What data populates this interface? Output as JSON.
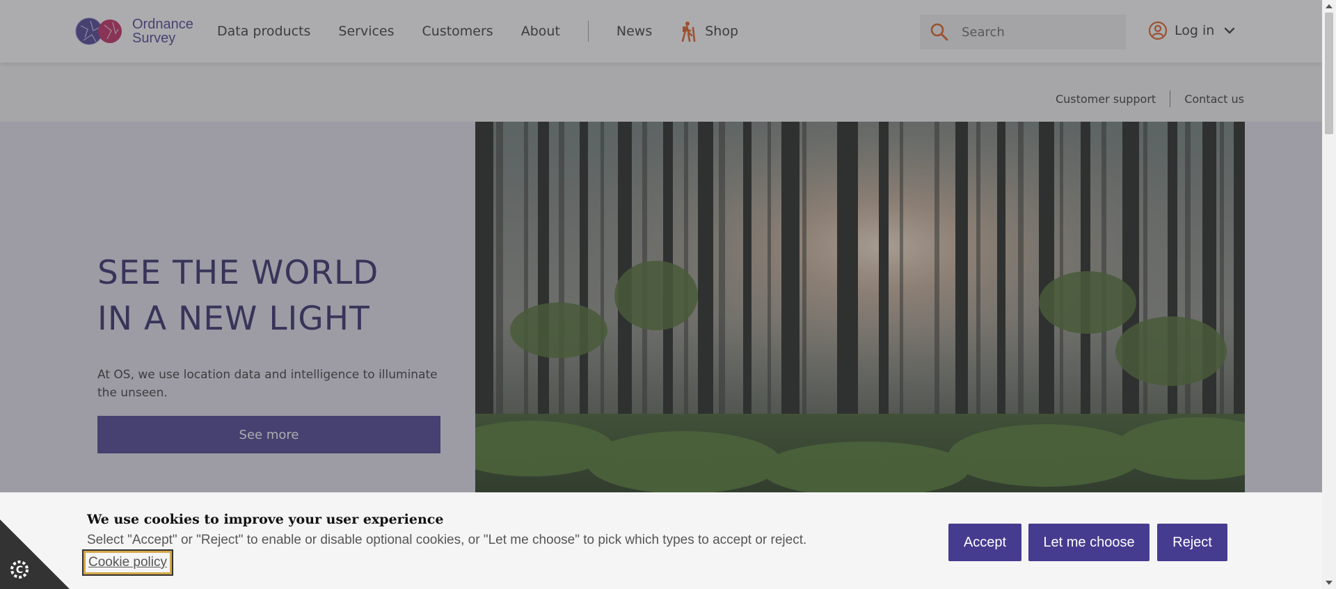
{
  "header": {
    "logo_text_line1": "Ordnance",
    "logo_text_line2": "Survey",
    "nav": [
      "Data products",
      "Services",
      "Customers",
      "About"
    ],
    "news": "News",
    "shop": "Shop",
    "search_placeholder": "Search",
    "login": "Log in"
  },
  "sublinks": {
    "support": "Customer support",
    "contact": "Contact us"
  },
  "hero": {
    "title_line1": "SEE THE WORLD",
    "title_line2": "IN A NEW LIGHT",
    "description": "At OS, we use location data and intelligence to illuminate the unseen.",
    "button": "See more"
  },
  "cookie": {
    "title": "We use cookies to improve your user experience",
    "text": "Select \"Accept\" or \"Reject\" to enable or disable optional cookies, or \"Let me choose\" to pick which types to accept or reject.",
    "policy_link": "Cookie policy",
    "accept": "Accept",
    "choose": "Let me choose",
    "reject": "Reject"
  },
  "colors": {
    "brand_purple": "#453c90",
    "accent_orange": "#e05a1c",
    "logo_magenta": "#c0255f"
  },
  "icons": [
    "os-logo",
    "hiker-icon",
    "search-icon",
    "user-circle-icon",
    "chevron-down-icon",
    "cookie-settings-icon"
  ]
}
